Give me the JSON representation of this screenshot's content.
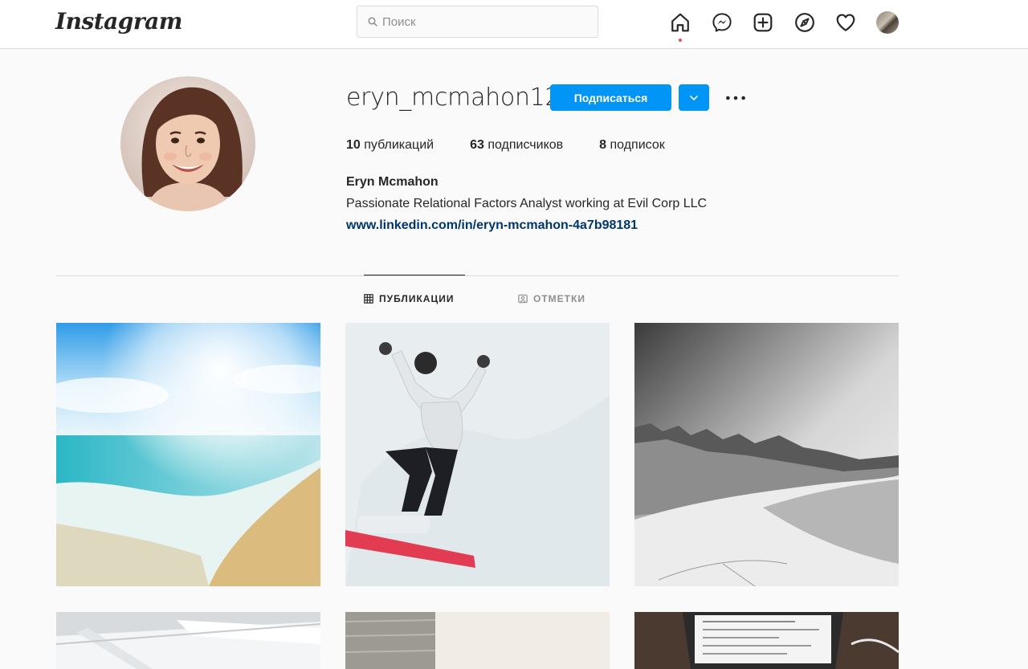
{
  "header": {
    "logo": "Instagram",
    "search_placeholder": "Поиск"
  },
  "profile": {
    "username": "eryn_mcmahon12",
    "follow_label": "Подписаться",
    "stats": {
      "posts_count": "10",
      "posts_label": " публикаций",
      "followers_count": "63",
      "followers_label": " подписчиков",
      "following_count": "8",
      "following_label": " подписок"
    },
    "full_name": "Eryn Mcmahon",
    "bio": "Passionate Relational Factors Analyst working at Evil Corp LLC",
    "link": "www.linkedin.com/in/eryn-mcmahon-4a7b98181"
  },
  "tabs": {
    "posts": "ПУБЛИКАЦИИ",
    "tagged": "ОТМЕТКИ"
  },
  "icons": [
    "search-icon",
    "home-icon",
    "messenger-icon",
    "new-post-icon",
    "explore-icon",
    "activity-heart-icon",
    "chevron-down-icon",
    "more-dots-icon",
    "grid-icon",
    "tagged-icon"
  ],
  "colors": {
    "accent": "#0095f6",
    "link": "#00376b",
    "notification_dot": "#ed4956"
  }
}
